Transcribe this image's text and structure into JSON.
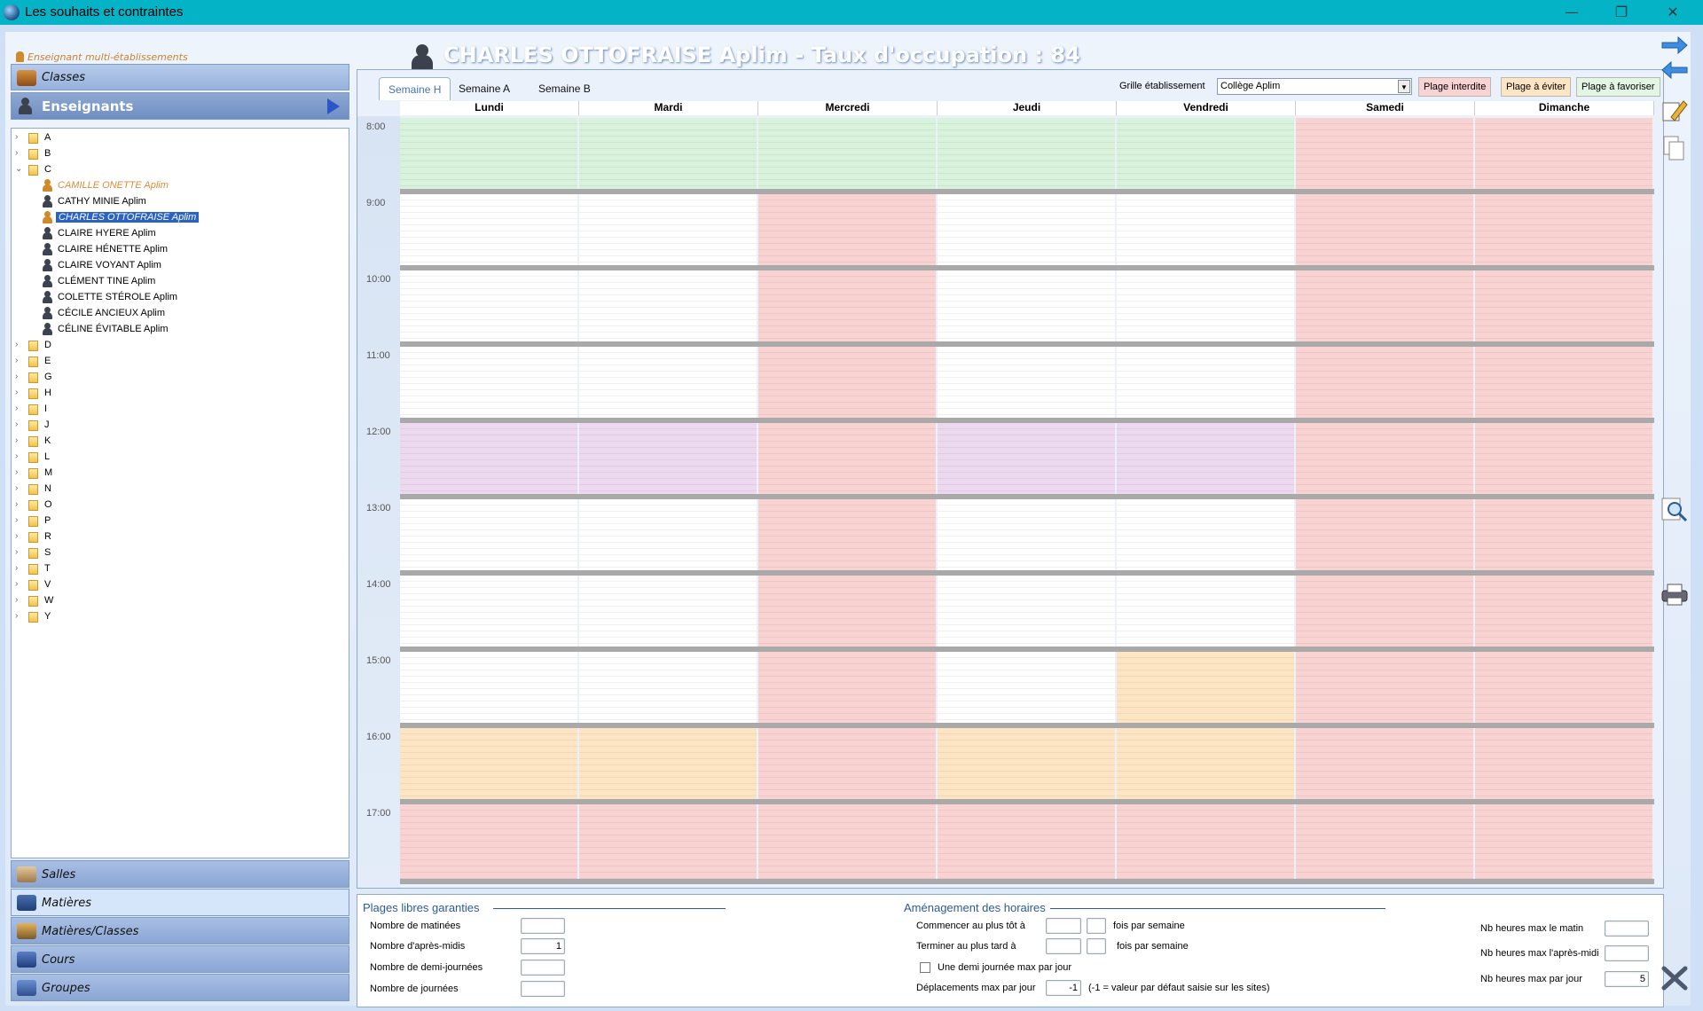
{
  "window": {
    "title": "Les souhaits et contraintes",
    "btn_min": "—",
    "btn_restore": "❐",
    "btn_close": "✕"
  },
  "header": {
    "title": "CHARLES OTTOFRAISE Aplim - Taux d'occupation : 84"
  },
  "left": {
    "multi_label": "Enseignant multi-établissements",
    "classes": "Classes",
    "enseignants": "Enseignants",
    "tree": [
      {
        "label": "A",
        "type": "folder"
      },
      {
        "label": "B",
        "type": "folder"
      },
      {
        "label": "C",
        "type": "folder",
        "open": true
      },
      {
        "label": "CAMILLE ONETTE Aplim",
        "type": "teacher",
        "style": "orange"
      },
      {
        "label": "CATHY MINIE Aplim",
        "type": "teacher"
      },
      {
        "label": "CHARLES OTTOFRAISE Aplim",
        "type": "teacher",
        "style": "sel"
      },
      {
        "label": "CLAIRE HYERE Aplim",
        "type": "teacher"
      },
      {
        "label": "CLAIRE HÉNETTE Aplim",
        "type": "teacher"
      },
      {
        "label": "CLAIRE VOYANT Aplim",
        "type": "teacher"
      },
      {
        "label": "CLÉMENT TINE Aplim",
        "type": "teacher"
      },
      {
        "label": "COLETTE STÉROLE Aplim",
        "type": "teacher"
      },
      {
        "label": "CÉCILE ANCIEUX Aplim",
        "type": "teacher"
      },
      {
        "label": "CÉLINE ÉVITABLE Aplim",
        "type": "teacher"
      },
      {
        "label": "D",
        "type": "folder"
      },
      {
        "label": "E",
        "type": "folder"
      },
      {
        "label": "G",
        "type": "folder"
      },
      {
        "label": "H",
        "type": "folder"
      },
      {
        "label": "I",
        "type": "folder"
      },
      {
        "label": "J",
        "type": "folder"
      },
      {
        "label": "K",
        "type": "folder"
      },
      {
        "label": "L",
        "type": "folder"
      },
      {
        "label": "M",
        "type": "folder"
      },
      {
        "label": "N",
        "type": "folder"
      },
      {
        "label": "O",
        "type": "folder"
      },
      {
        "label": "P",
        "type": "folder"
      },
      {
        "label": "R",
        "type": "folder"
      },
      {
        "label": "S",
        "type": "folder"
      },
      {
        "label": "T",
        "type": "folder"
      },
      {
        "label": "V",
        "type": "folder"
      },
      {
        "label": "W",
        "type": "folder"
      },
      {
        "label": "Y",
        "type": "folder"
      }
    ],
    "bottom": [
      "Salles",
      "Matières",
      "Matières/Classes",
      "Cours",
      "Groupes"
    ]
  },
  "tabs": [
    "Semaine H",
    "Semaine A",
    "Semaine B"
  ],
  "grille": {
    "label": "Grille établissement",
    "value": "Collège Aplim"
  },
  "legend": {
    "interdite": "Plage interdite",
    "eviter": "Plage à éviter",
    "favoriser": "Plage à favoriser"
  },
  "colors": {
    "interdite": "#f9d2d2",
    "eviter": "#fde5c4",
    "favoriser": "#d9f2dc",
    "libre": "#ffffff",
    "pause": "#ecd9f0"
  },
  "days": [
    "Lundi",
    "Mardi",
    "Mercredi",
    "Jeudi",
    "Vendredi",
    "Samedi",
    "Dimanche"
  ],
  "hours": [
    "8:00",
    "9:00",
    "10:00",
    "11:00",
    "12:00",
    "13:00",
    "14:00",
    "15:00",
    "16:00",
    "17:00"
  ],
  "schedule": [
    [
      "F",
      "F",
      "F",
      "F",
      "F",
      "I",
      "I"
    ],
    [
      "L",
      "L",
      "I",
      "L",
      "L",
      "I",
      "I"
    ],
    [
      "L",
      "L",
      "I",
      "L",
      "L",
      "I",
      "I"
    ],
    [
      "L",
      "L",
      "I",
      "L",
      "L",
      "I",
      "I"
    ],
    [
      "P",
      "P",
      "I",
      "P",
      "P",
      "I",
      "I"
    ],
    [
      "L",
      "L",
      "I",
      "L",
      "L",
      "I",
      "I"
    ],
    [
      "L",
      "L",
      "I",
      "L",
      "L",
      "I",
      "I"
    ],
    [
      "L",
      "L",
      "I",
      "L",
      "E",
      "I",
      "I"
    ],
    [
      "E",
      "E",
      "I",
      "E",
      "E",
      "I",
      "I"
    ],
    [
      "I",
      "I",
      "I",
      "I",
      "I",
      "I",
      "I"
    ]
  ],
  "plages": {
    "title": "Plages libres garanties",
    "matinees": {
      "label": "Nombre de matinées",
      "value": ""
    },
    "apresmidis": {
      "label": "Nombre d'après-midis",
      "value": "1"
    },
    "demijournees": {
      "label": "Nombre de demi-journées",
      "value": ""
    },
    "journees": {
      "label": "Nombre de journées",
      "value": ""
    }
  },
  "amenagement": {
    "title": "Aménagement des horaires",
    "commencer": "Commencer au plus tôt à",
    "terminer": "Terminer au plus tard à",
    "fois1": "fois par semaine",
    "fois2": "fois par semaine",
    "demi": "Une demi journée max par jour",
    "deplacements": "Déplacements max par jour",
    "deplacements_value": "-1",
    "deplacements_note": "(-1 = valeur par défaut saisie sur les sites)"
  },
  "maxh": {
    "matin": {
      "label": "Nb heures max le matin",
      "value": ""
    },
    "aprem": {
      "label": "Nb heures max l'après-midi",
      "value": ""
    },
    "jour": {
      "label": "Nb heures max par jour",
      "value": "5"
    }
  }
}
